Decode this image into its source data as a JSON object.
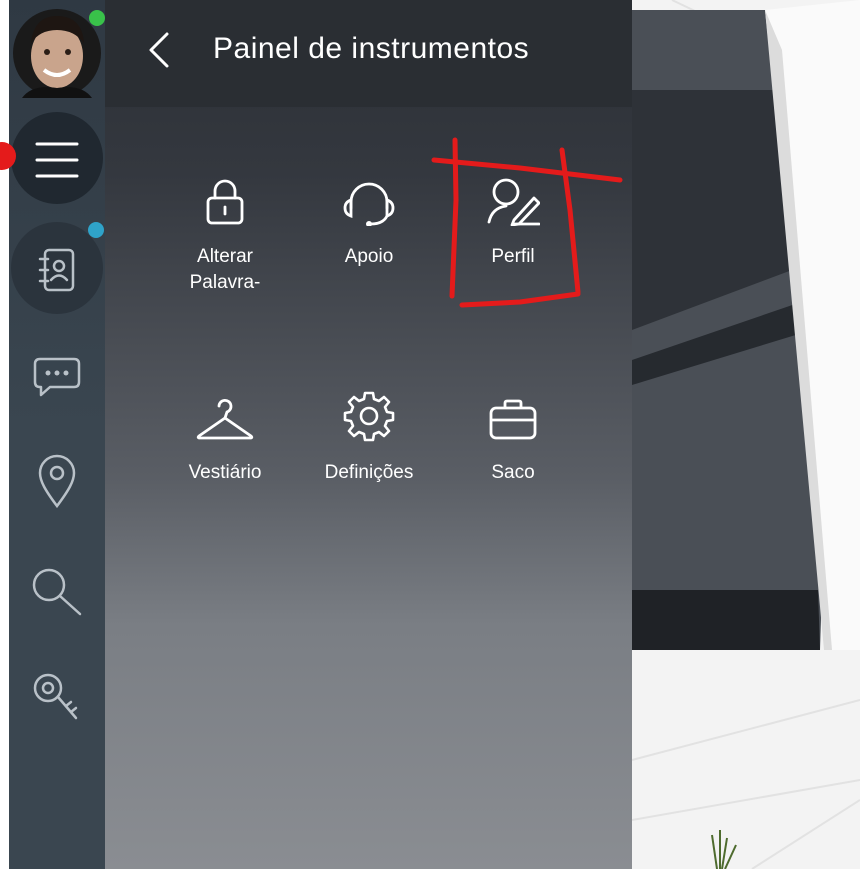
{
  "panel": {
    "title": "Painel de instrumentos"
  },
  "tiles": [
    {
      "label": "Alterar Palavra-",
      "icon": "lock-icon"
    },
    {
      "label": "Apoio",
      "icon": "headset-icon"
    },
    {
      "label": "Perfil",
      "icon": "profile-edit-icon"
    },
    {
      "label": "Vestiário",
      "icon": "hanger-icon"
    },
    {
      "label": "Definições",
      "icon": "gear-icon"
    },
    {
      "label": "Saco",
      "icon": "briefcase-icon"
    }
  ],
  "rail": {
    "items": [
      "avatar",
      "menu-icon",
      "contacts-icon",
      "chat-icon",
      "location-icon",
      "search-icon",
      "key-icon"
    ]
  },
  "colors": {
    "online_dot": "#39c24a",
    "notification_dot": "#2fa3c9",
    "annotation_red": "#e41b1b"
  }
}
